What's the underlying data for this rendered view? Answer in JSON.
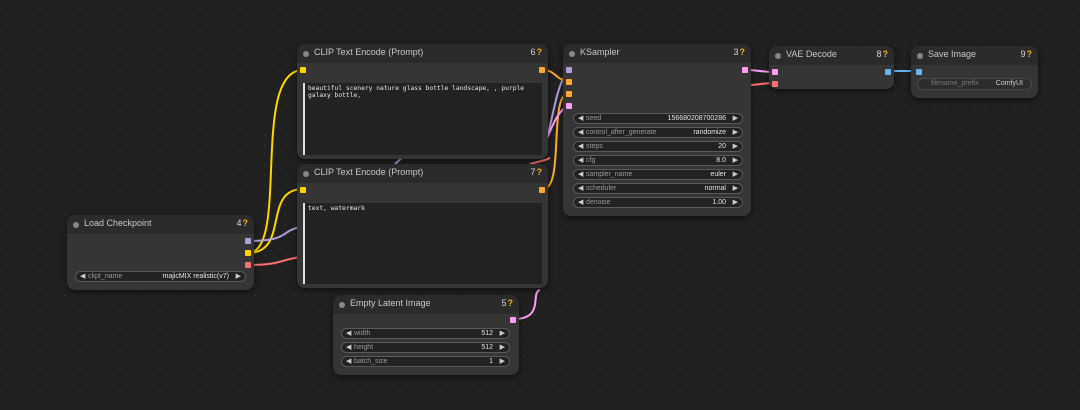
{
  "nodes": {
    "load_checkpoint": {
      "title": "Load Checkpoint",
      "id": "4",
      "widgets": [
        {
          "label": "ckpt_name",
          "value": "majicMIX realistic(v7)"
        }
      ]
    },
    "clip_pos": {
      "title": "CLIP Text Encode (Prompt)",
      "id": "6",
      "text": "beautiful scenery nature glass bottle landscape, , purple galaxy bottle,"
    },
    "clip_neg": {
      "title": "CLIP Text Encode (Prompt)",
      "id": "7",
      "text": "text, watermark"
    },
    "ksampler": {
      "title": "KSampler",
      "id": "3",
      "widgets": [
        {
          "label": "seed",
          "value": "156680208700286"
        },
        {
          "label": "control_after_generate",
          "value": "randomize"
        },
        {
          "label": "steps",
          "value": "20"
        },
        {
          "label": "cfg",
          "value": "8.0"
        },
        {
          "label": "sampler_name",
          "value": "euler"
        },
        {
          "label": "scheduler",
          "value": "normal"
        },
        {
          "label": "denoise",
          "value": "1.00"
        }
      ]
    },
    "vae_decode": {
      "title": "VAE Decode",
      "id": "8"
    },
    "save_image": {
      "title": "Save Image",
      "id": "9",
      "widgets": [
        {
          "label": "filename_prefix",
          "value": "ComfyUI"
        }
      ]
    },
    "empty_latent": {
      "title": "Empty Latent Image",
      "id": "5",
      "widgets": [
        {
          "label": "width",
          "value": "512"
        },
        {
          "label": "height",
          "value": "512"
        },
        {
          "label": "batch_size",
          "value": "1"
        }
      ]
    }
  },
  "colors": {
    "model": "#b39ddb",
    "clip": "#ffd500",
    "vae": "#ff6e6e",
    "conditioning": "#ffa931",
    "latent": "#ff9cf9",
    "image": "#64b5f6"
  },
  "icons": {
    "left_arrow": "◀",
    "right_arrow": "▶",
    "mark": "?"
  }
}
